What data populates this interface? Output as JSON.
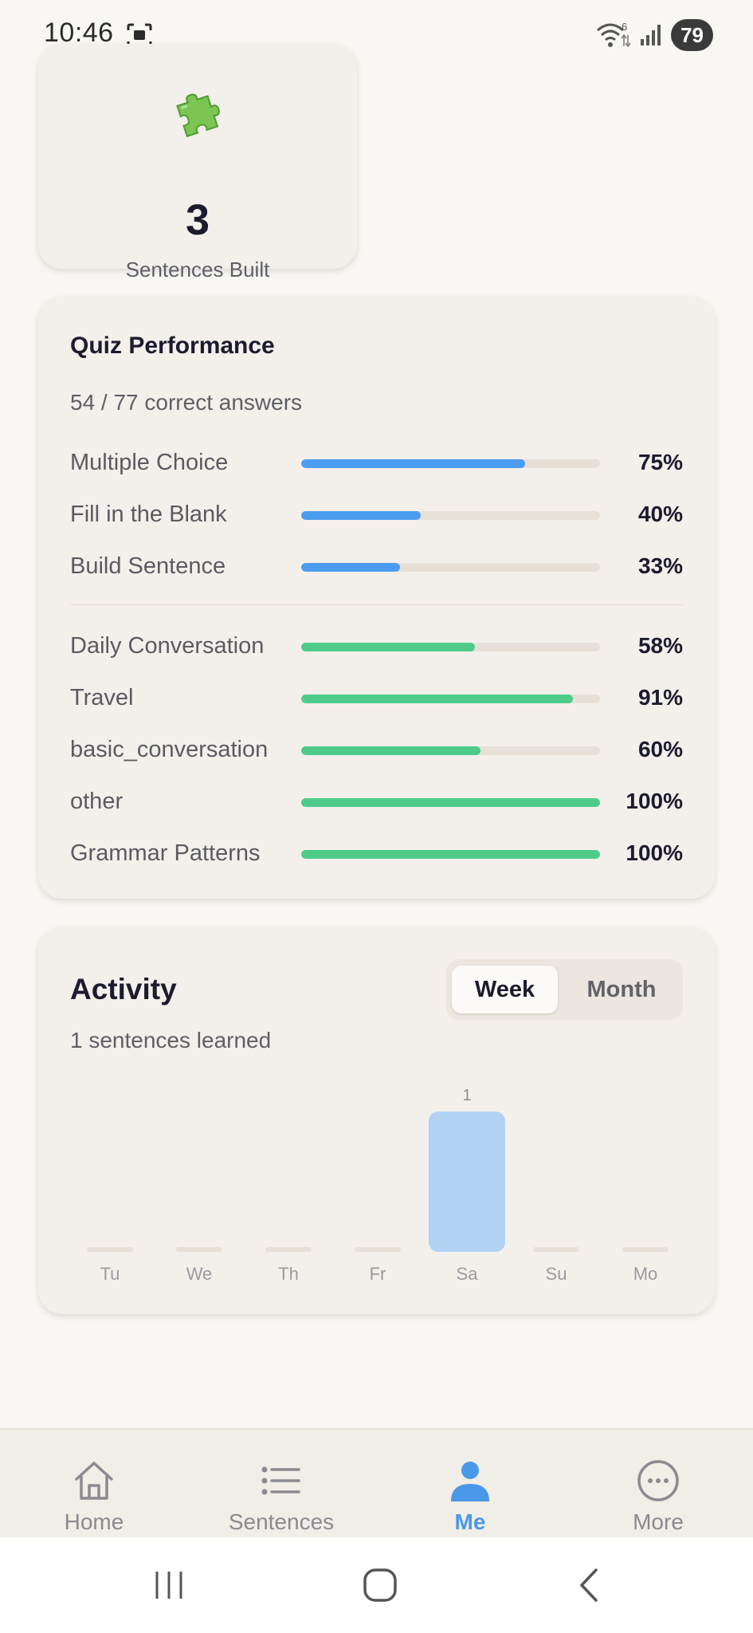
{
  "status": {
    "time": "10:46",
    "battery": "79",
    "wifi_label": "6"
  },
  "built_card": {
    "value": "3",
    "label": "Sentences Built",
    "icon": "puzzle-icon"
  },
  "quiz": {
    "title": "Quiz Performance",
    "subtitle": "54 / 77 correct answers",
    "types": [
      {
        "label": "Multiple Choice",
        "pct": "75%",
        "value": 75
      },
      {
        "label": "Fill in the Blank",
        "pct": "40%",
        "value": 40
      },
      {
        "label": "Build Sentence",
        "pct": "33%",
        "value": 33
      }
    ],
    "categories": [
      {
        "label": "Daily Conversation",
        "pct": "58%",
        "value": 58
      },
      {
        "label": "Travel",
        "pct": "91%",
        "value": 91
      },
      {
        "label": "basic_conversation",
        "pct": "60%",
        "value": 60
      },
      {
        "label": "other",
        "pct": "100%",
        "value": 100
      },
      {
        "label": "Grammar Patterns",
        "pct": "100%",
        "value": 100
      }
    ],
    "colors": {
      "type_bar": "#4c9df0",
      "category_bar": "#4ecb8a",
      "track": "#e6e0d8"
    }
  },
  "activity": {
    "title": "Activity",
    "subtitle": "1 sentences learned",
    "toggle": {
      "week": "Week",
      "month": "Month",
      "selected": "Week"
    }
  },
  "chart_data": {
    "type": "bar",
    "categories": [
      "Tu",
      "We",
      "Th",
      "Fr",
      "Sa",
      "Su",
      "Mo"
    ],
    "values": [
      0,
      0,
      0,
      0,
      1,
      0,
      0
    ],
    "data_labels": [
      "",
      "",
      "",
      "",
      "1",
      "",
      ""
    ],
    "ylim": [
      0,
      1
    ],
    "bar_color": "#b2d2f4",
    "empty_color": "#e6e0d8",
    "grid": false
  },
  "nav": {
    "items": [
      {
        "label": "Home",
        "icon": "home-icon",
        "active": false
      },
      {
        "label": "Sentences",
        "icon": "list-icon",
        "active": false
      },
      {
        "label": "Me",
        "icon": "person-icon",
        "active": true
      },
      {
        "label": "More",
        "icon": "more-icon",
        "active": false
      }
    ]
  }
}
